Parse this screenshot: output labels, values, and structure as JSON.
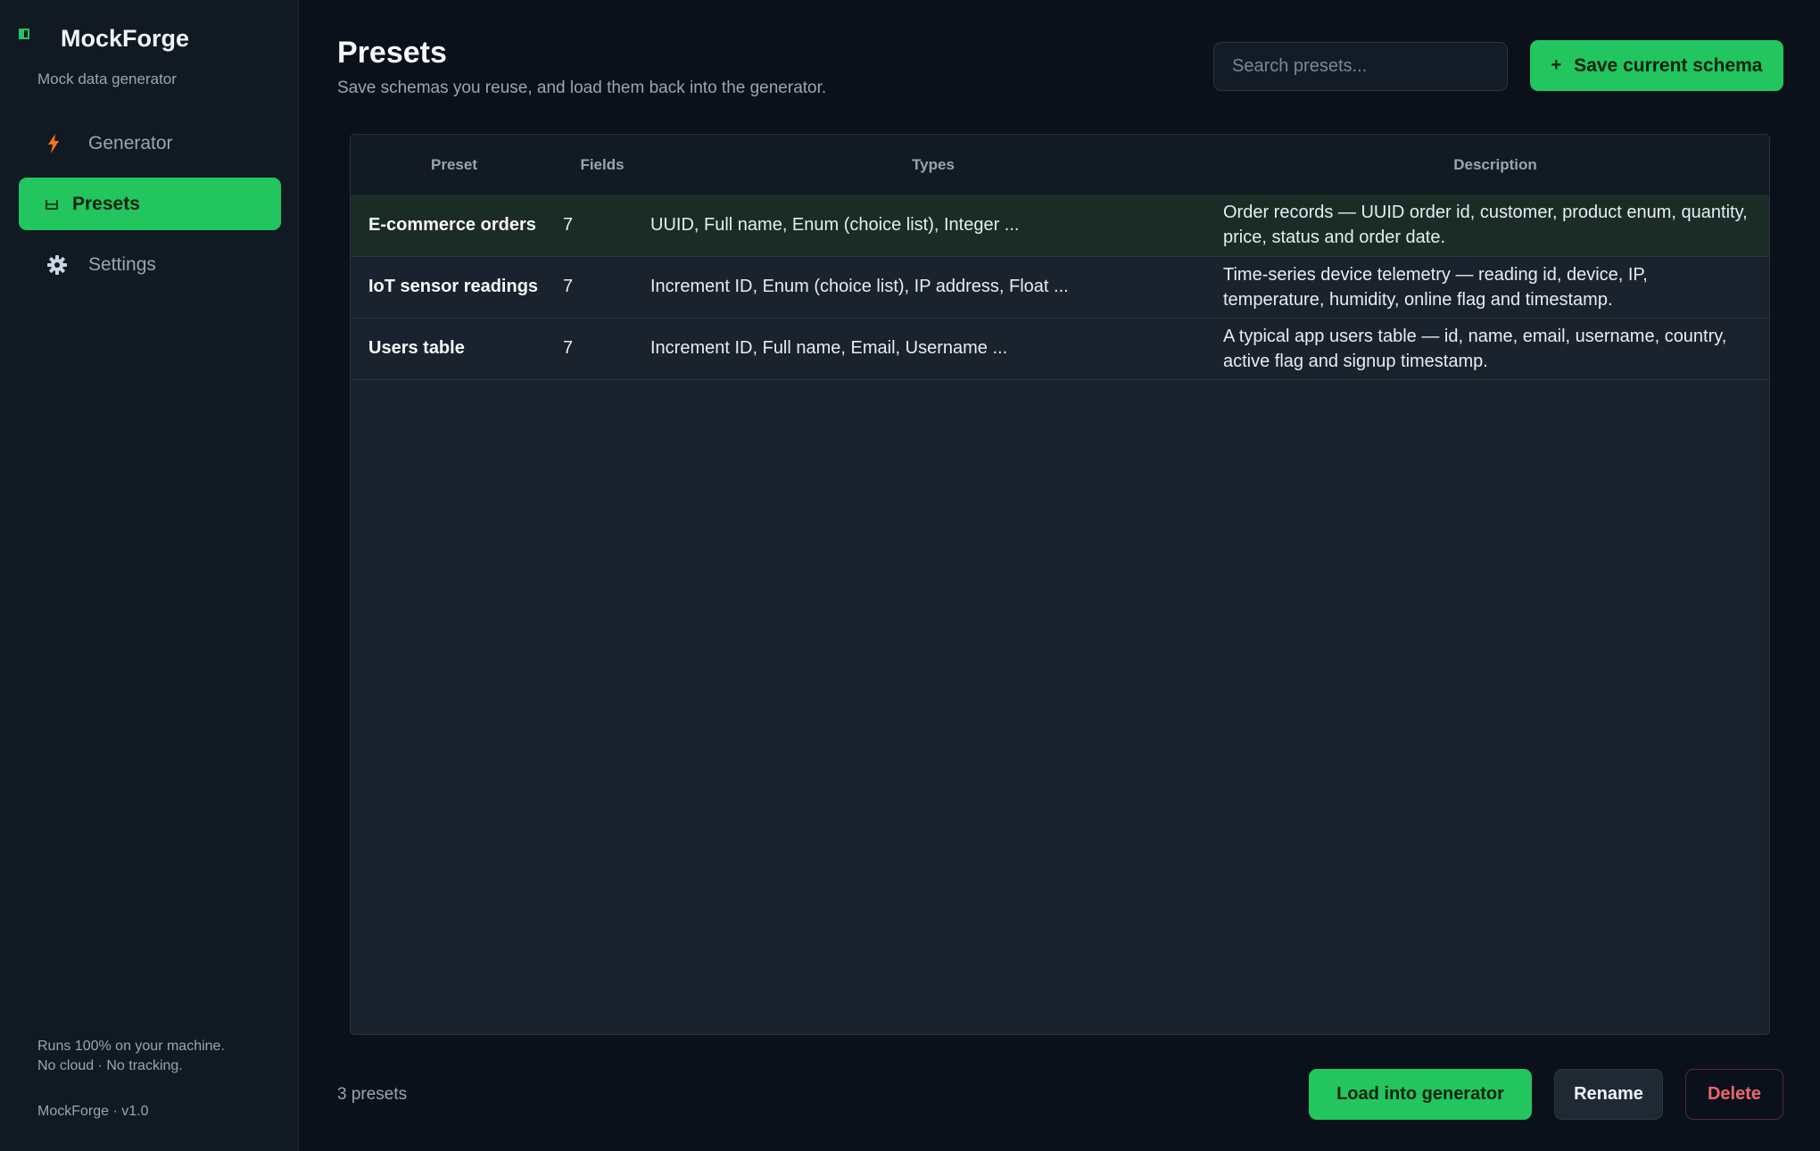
{
  "app": {
    "name": "MockForge",
    "tagline": "Mock data generator",
    "footer_line1": "Runs 100% on your machine.",
    "footer_line2": "No cloud · No tracking.",
    "version": "MockForge · v1.0"
  },
  "sidebar": {
    "items": [
      {
        "label": "Generator",
        "icon": "lightning-icon",
        "active": false
      },
      {
        "label": "Presets",
        "icon": "bookmark-icon",
        "active": true
      },
      {
        "label": "Settings",
        "icon": "gear-icon",
        "active": false
      }
    ]
  },
  "header": {
    "title": "Presets",
    "subtitle": "Save schemas you reuse, and load them back into the generator.",
    "search_placeholder": "Search presets...",
    "save_label": "Save current schema"
  },
  "table": {
    "columns": [
      "Preset",
      "Fields",
      "Types",
      "Description"
    ],
    "rows": [
      {
        "name": "E-commerce orders",
        "fields": "7",
        "types": "UUID, Full name, Enum (choice list), Integer ...",
        "description": "Order records — UUID order id, customer, product enum, quantity, price, status and order date.",
        "selected": true
      },
      {
        "name": "IoT sensor readings",
        "fields": "7",
        "types": "Increment ID, Enum (choice list), IP address, Float ...",
        "description": "Time-series device telemetry — reading id, device, IP, temperature, humidity, online flag and timestamp.",
        "selected": false
      },
      {
        "name": "Users table",
        "fields": "7",
        "types": "Increment ID, Full name, Email, Username ...",
        "description": "A typical app users table — id, name, email, username, country, active flag and signup timestamp.",
        "selected": false
      }
    ]
  },
  "footer": {
    "count": "3 presets",
    "load_label": "Load into generator",
    "rename_label": "Rename",
    "delete_label": "Delete"
  },
  "colors": {
    "accent": "#22c55e",
    "danger": "#f06470",
    "background": "#0b111a",
    "sidebar": "#111922"
  }
}
